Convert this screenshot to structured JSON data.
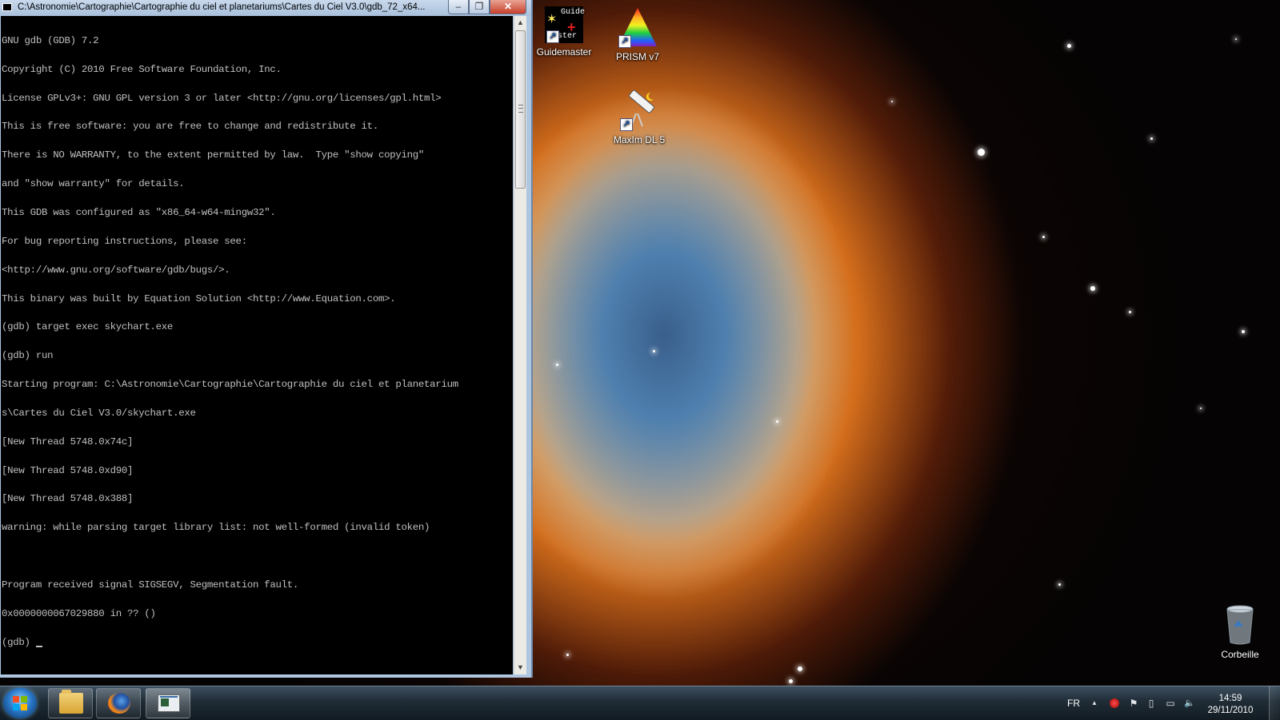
{
  "console": {
    "title": "C:\\Astronomie\\Cartographie\\Cartographie du ciel et planetariums\\Cartes du Ciel V3.0\\gdb_72_x64...",
    "buttons": {
      "minimize": "–",
      "maximize": "❐",
      "close": "✕"
    },
    "lines": [
      "GNU gdb (GDB) 7.2",
      "Copyright (C) 2010 Free Software Foundation, Inc.",
      "License GPLv3+: GNU GPL version 3 or later <http://gnu.org/licenses/gpl.html>",
      "This is free software: you are free to change and redistribute it.",
      "There is NO WARRANTY, to the extent permitted by law.  Type \"show copying\"",
      "and \"show warranty\" for details.",
      "This GDB was configured as \"x86_64-w64-mingw32\".",
      "For bug reporting instructions, please see:",
      "<http://www.gnu.org/software/gdb/bugs/>.",
      "This binary was built by Equation Solution <http://www.Equation.com>.",
      "(gdb) target exec skychart.exe",
      "(gdb) run",
      "Starting program: C:\\Astronomie\\Cartographie\\Cartographie du ciel et planetarium",
      "s\\Cartes du Ciel V3.0/skychart.exe",
      "[New Thread 5748.0x74c]",
      "[New Thread 5748.0xd90]",
      "[New Thread 5748.0x388]",
      "warning: while parsing target library list: not well-formed (invalid token)",
      "",
      "Program received signal SIGSEGV, Segmentation fault.",
      "0x0000000067029880 in ?? ()"
    ],
    "prompt": "(gdb) "
  },
  "desktop_icons": [
    {
      "label": "Guidemaster",
      "overlay_top": "Guide",
      "overlay_bottom": "ster",
      "icon": "guidemaster-icon"
    },
    {
      "label": "PRISM v7",
      "icon": "prism-icon"
    },
    {
      "label": "MaxIm DL 5",
      "icon": "telescope-icon"
    },
    {
      "label": "Corbeille",
      "icon": "recycle-bin-icon"
    }
  ],
  "taskbar": {
    "language": "FR",
    "time": "14:59",
    "date": "29/11/2010",
    "tray_icons": [
      "show-hidden-icons-arrow",
      "antivirus-icon",
      "action-center-flag-icon",
      "network-icon",
      "display-icon",
      "volume-icon"
    ],
    "tray_glyphs": {
      "arrow": "▲",
      "flag": "⚑",
      "network": "▯",
      "display": "▭",
      "volume": "🔈"
    },
    "pinned": [
      "windows-explorer",
      "firefox",
      "console"
    ]
  },
  "colors": {
    "console_bg": "#000000",
    "console_text": "#c0c0c0",
    "titlebar": "#a9c0dc",
    "close_button": "#c7402a",
    "taskbar": "#1f2c36"
  }
}
